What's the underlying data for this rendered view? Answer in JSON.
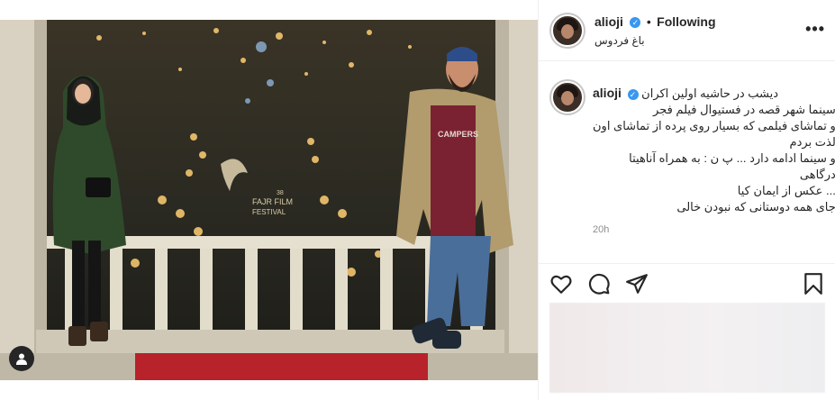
{
  "post": {
    "username": "alioji",
    "follow_label": "Following",
    "location": "باغ فردوس",
    "caption_lines": [
      "دیشب در حاشیه اولین اکران",
      "سینما شهر قصه در فستیوال فیلم فجر",
      "و تماشای فیلمی که بسیار روی پرده از تماشای اون",
      "لذت بردم",
      "و سینما ادامه دارد ... پ ن : به همراه آناهیتا",
      "درگاهی",
      "... عکس از ایمان کیا",
      "جای همه دوستانی که نبودن خالی"
    ],
    "timestamp": "20h",
    "more_label": "•••"
  },
  "photo": {
    "watermark_title": "FAJR FILM",
    "watermark_sub": "FESTIVAL",
    "watermark_num": "38",
    "shirt_text": "CAMPERS"
  },
  "icons": {
    "like": "heart-icon",
    "comment": "comment-icon",
    "share": "share-icon",
    "save": "bookmark-icon",
    "tag": "user-tag-icon",
    "verified": "verified-badge-icon"
  },
  "colors": {
    "verified": "#3897f0",
    "carpet": "#b8222a"
  }
}
